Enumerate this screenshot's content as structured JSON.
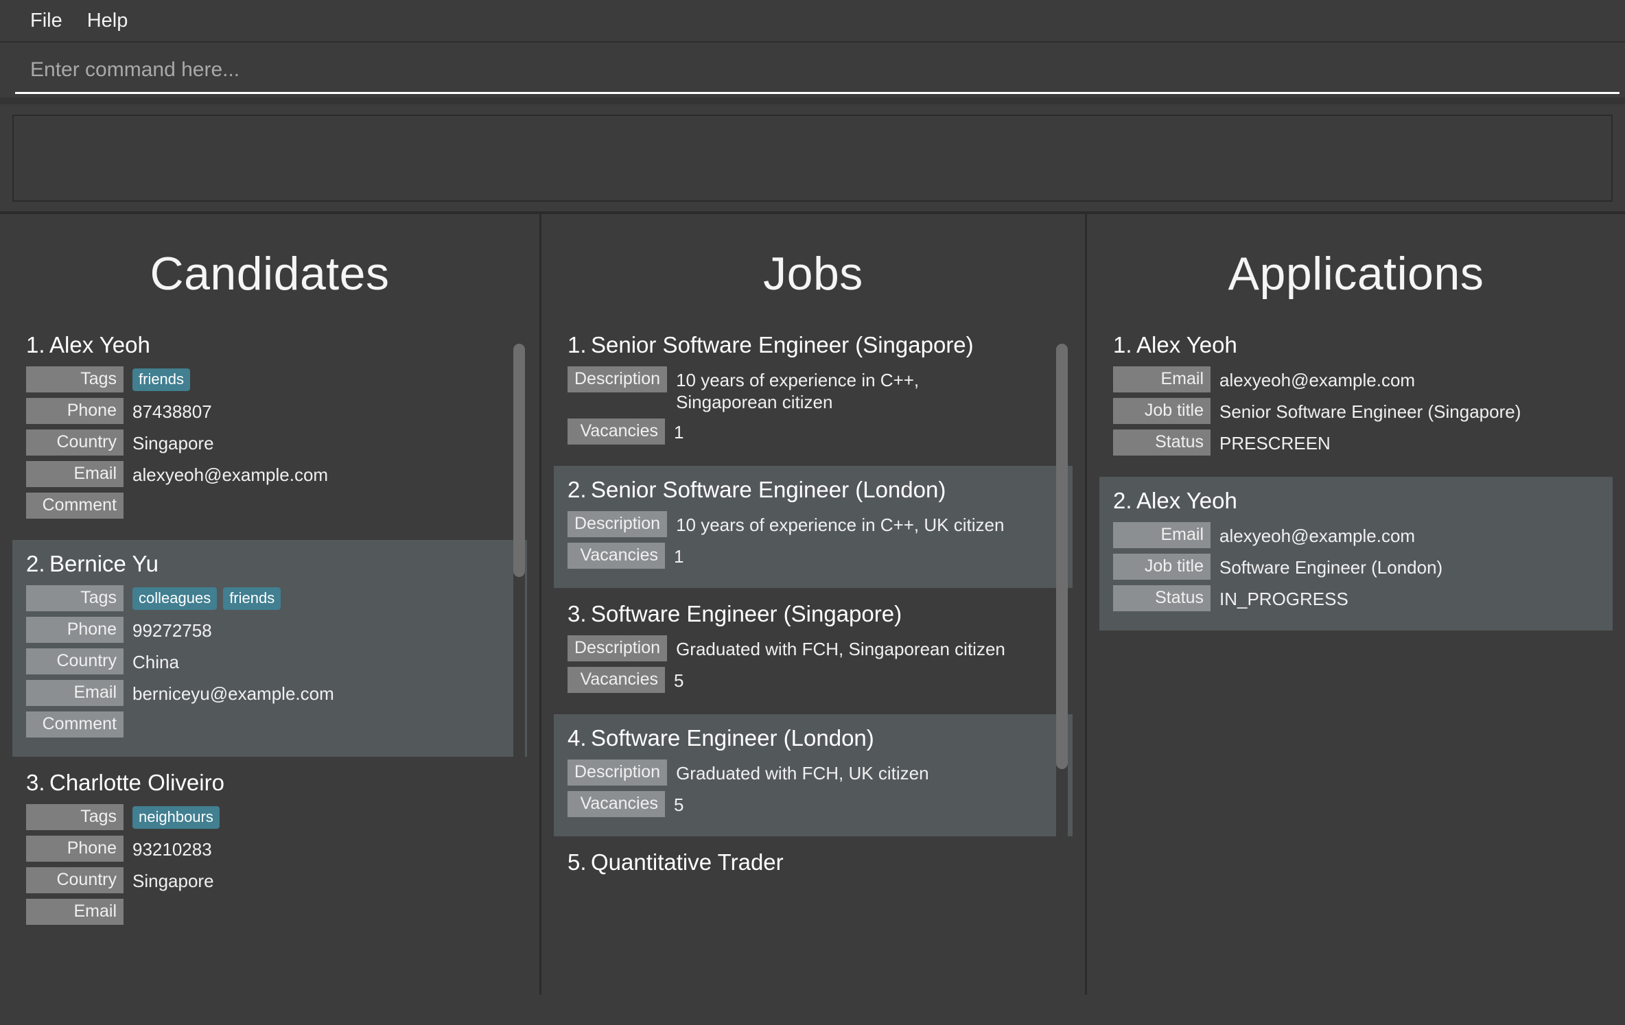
{
  "menu": {
    "items": [
      {
        "label": "File"
      },
      {
        "label": "Help"
      }
    ]
  },
  "command": {
    "placeholder": "Enter command here...",
    "value": ""
  },
  "result": {
    "text": ""
  },
  "colors": {
    "background": "#3c3c3c",
    "selected_card": "#53585b",
    "field_label": "#7e7e7e",
    "tag": "#417f91",
    "divider": "#2b2b2b",
    "scrollbar_thumb": "#6e6e6e",
    "text": "#f0f0f0"
  },
  "panels": {
    "candidates": {
      "title": "Candidates",
      "items": [
        {
          "index": "1.",
          "name": "Alex Yeoh",
          "selected": false,
          "tags_label": "Tags",
          "tags": [
            "friends"
          ],
          "fields": [
            {
              "label": "Phone",
              "value": "87438807"
            },
            {
              "label": "Country",
              "value": "Singapore"
            },
            {
              "label": "Email",
              "value": "alexyeoh@example.com"
            },
            {
              "label": "Comment",
              "value": ""
            }
          ]
        },
        {
          "index": "2.",
          "name": "Bernice Yu",
          "selected": true,
          "tags_label": "Tags",
          "tags": [
            "colleagues",
            "friends"
          ],
          "fields": [
            {
              "label": "Phone",
              "value": "99272758"
            },
            {
              "label": "Country",
              "value": "China"
            },
            {
              "label": "Email",
              "value": "berniceyu@example.com"
            },
            {
              "label": "Comment",
              "value": ""
            }
          ]
        },
        {
          "index": "3.",
          "name": "Charlotte Oliveiro",
          "selected": false,
          "tags_label": "Tags",
          "tags": [
            "neighbours"
          ],
          "fields": [
            {
              "label": "Phone",
              "value": "93210283"
            },
            {
              "label": "Country",
              "value": "Singapore"
            },
            {
              "label": "Email",
              "value": ""
            }
          ]
        }
      ]
    },
    "jobs": {
      "title": "Jobs",
      "items": [
        {
          "index": "1.",
          "name": "Senior Software Engineer (Singapore)",
          "selected": false,
          "fields": [
            {
              "label": "Description",
              "value": "10 years of experience in C++, Singaporean citizen"
            },
            {
              "label": "Vacancies",
              "value": "1"
            }
          ]
        },
        {
          "index": "2.",
          "name": "Senior Software Engineer (London)",
          "selected": true,
          "fields": [
            {
              "label": "Description",
              "value": "10 years of experience in C++, UK citizen"
            },
            {
              "label": "Vacancies",
              "value": "1"
            }
          ]
        },
        {
          "index": "3.",
          "name": "Software Engineer (Singapore)",
          "selected": false,
          "fields": [
            {
              "label": "Description",
              "value": "Graduated with FCH, Singaporean citizen"
            },
            {
              "label": "Vacancies",
              "value": "5"
            }
          ]
        },
        {
          "index": "4.",
          "name": "Software Engineer (London)",
          "selected": true,
          "fields": [
            {
              "label": "Description",
              "value": "Graduated with FCH, UK citizen"
            },
            {
              "label": "Vacancies",
              "value": "5"
            }
          ]
        },
        {
          "index": "5.",
          "name": "Quantitative Trader",
          "selected": false,
          "fields": []
        }
      ]
    },
    "applications": {
      "title": "Applications",
      "items": [
        {
          "index": "1.",
          "name": "Alex Yeoh",
          "selected": false,
          "fields": [
            {
              "label": "Email",
              "value": "alexyeoh@example.com"
            },
            {
              "label": "Job title",
              "value": "Senior Software Engineer (Singapore)"
            },
            {
              "label": "Status",
              "value": "PRESCREEN"
            }
          ]
        },
        {
          "index": "2.",
          "name": "Alex Yeoh",
          "selected": true,
          "fields": [
            {
              "label": "Email",
              "value": "alexyeoh@example.com"
            },
            {
              "label": "Job title",
              "value": "Software Engineer (London)"
            },
            {
              "label": "Status",
              "value": "IN_PROGRESS"
            }
          ]
        }
      ]
    }
  }
}
